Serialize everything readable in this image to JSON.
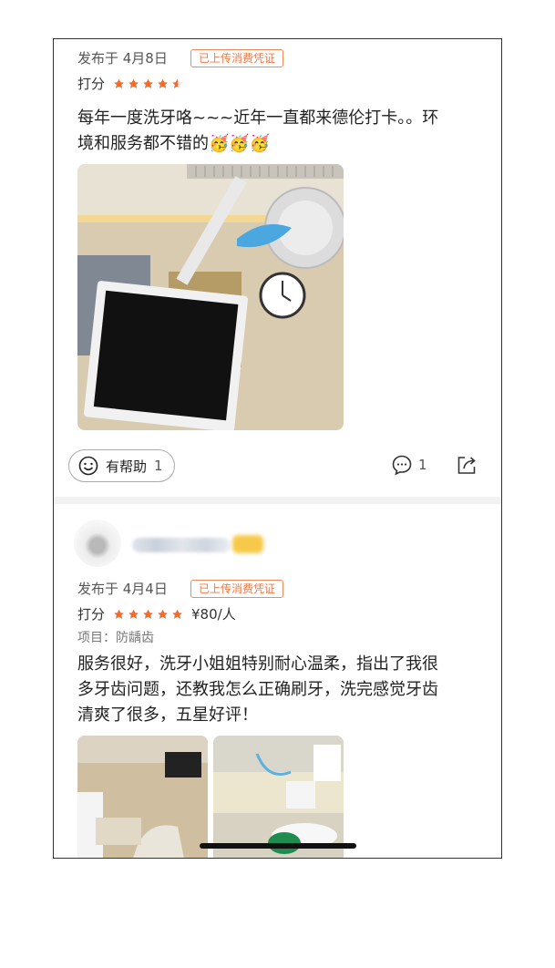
{
  "review1": {
    "date": "发布于 4月8日",
    "voucher": "已上传消费凭证",
    "rating_label": "打分",
    "stars": 4.5,
    "text_line1": "每年一度洗牙咯~~~近年一直都来德伦打卡。。环",
    "text_line2": "境和服务都不错的🥳🥳🥳",
    "helpful_label": "有帮助",
    "helpful_count": "1",
    "comment_count": "1"
  },
  "review2": {
    "date": "发布于 4月4日",
    "voucher": "已上传消费凭证",
    "rating_label": "打分",
    "stars": 5,
    "price": "¥80/人",
    "project": "项目：防龋齿",
    "text_line1": "服务很好，洗牙小姐姐特别耐心温柔，指出了我很",
    "text_line2": "多牙齿问题，还教我怎么正确刷牙，洗完感觉牙齿",
    "text_line3": "清爽了很多，五星好评！"
  },
  "colors": {
    "accent": "#f26a2e",
    "voucher_border": "#f08a5d"
  },
  "icons": [
    "smile-icon",
    "comment-icon",
    "share-icon",
    "avatar"
  ]
}
